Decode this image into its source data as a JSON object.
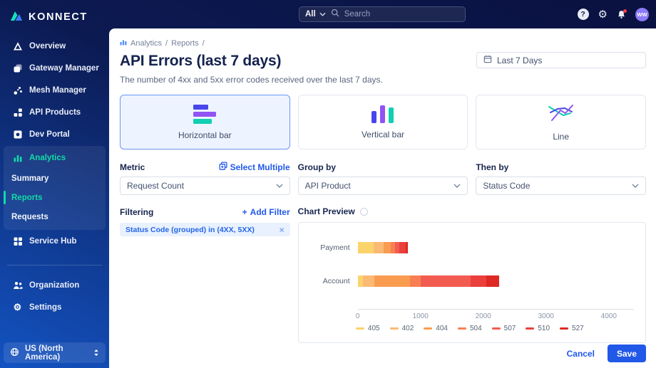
{
  "topbar": {
    "scope": "All",
    "search_placeholder": "Search",
    "avatar_initials": "WW"
  },
  "sidebar": {
    "logo_text": "KONNECT",
    "items": [
      {
        "label": "Overview"
      },
      {
        "label": "Gateway Manager"
      },
      {
        "label": "Mesh Manager"
      },
      {
        "label": "API Products"
      },
      {
        "label": "Dev Portal"
      }
    ],
    "analytics": {
      "label": "Analytics",
      "items": [
        {
          "label": "Summary",
          "active": false
        },
        {
          "label": "Reports",
          "active": true
        },
        {
          "label": "Requests",
          "active": false
        }
      ]
    },
    "service_hub_label": "Service Hub",
    "organization_label": "Organization",
    "settings_label": "Settings",
    "region_label": "US (North America)"
  },
  "breadcrumb": {
    "items": [
      "Analytics",
      "Reports"
    ],
    "separator": "/"
  },
  "header": {
    "title": "API Errors (last 7 days)",
    "subtitle": "The number of 4xx and 5xx error codes received over the last 7 days.",
    "date_range": "Last 7 Days"
  },
  "chart_types": [
    {
      "label": "Horizontal bar",
      "selected": true
    },
    {
      "label": "Vertical bar",
      "selected": false
    },
    {
      "label": "Line",
      "selected": false
    }
  ],
  "controls": {
    "metric_label": "Metric",
    "select_multiple_label": "Select Multiple",
    "metric_value": "Request Count",
    "group_by_label": "Group by",
    "group_by_value": "API Product",
    "then_by_label": "Then by",
    "then_by_value": "Status Code"
  },
  "filtering": {
    "label": "Filtering",
    "add_filter_label": "Add Filter",
    "add_filter_plus": "+",
    "filter_chip": "Status Code (grouped) in (4XX, 5XX)",
    "chip_close": "×"
  },
  "preview": {
    "label": "Chart Preview"
  },
  "footer": {
    "cancel_label": "Cancel",
    "save_label": "Save"
  },
  "colors": {
    "accent_blue": "#2059EA",
    "accent_teal": "#12DBA5",
    "save_bg": "#2158E8",
    "selected_card_bg": "#EEF4FF"
  },
  "chart_data": {
    "type": "bar",
    "orientation": "horizontal",
    "stacked": true,
    "title": "",
    "categories": [
      "Payment",
      "Account"
    ],
    "series": [
      {
        "name": "405",
        "color": "#FBD36B",
        "values": [
          250,
          80
        ]
      },
      {
        "name": "402",
        "color": "#FBBA74",
        "values": [
          165,
          190
        ]
      },
      {
        "name": "404",
        "color": "#FA9C50",
        "values": [
          110,
          560
        ]
      },
      {
        "name": "504",
        "color": "#F87F54",
        "values": [
          70,
          170
        ]
      },
      {
        "name": "507",
        "color": "#F25C50",
        "values": [
          70,
          795
        ]
      },
      {
        "name": "510",
        "color": "#EA3F3B",
        "values": [
          95,
          255
        ]
      },
      {
        "name": "527",
        "color": "#DE2823",
        "values": [
          40,
          200
        ]
      }
    ],
    "xticks": [
      0,
      1000,
      2000,
      3000,
      4000
    ],
    "xmax": 4400,
    "xlabel": "",
    "ylabel": "",
    "grid": false,
    "legend_position": "bottom"
  }
}
